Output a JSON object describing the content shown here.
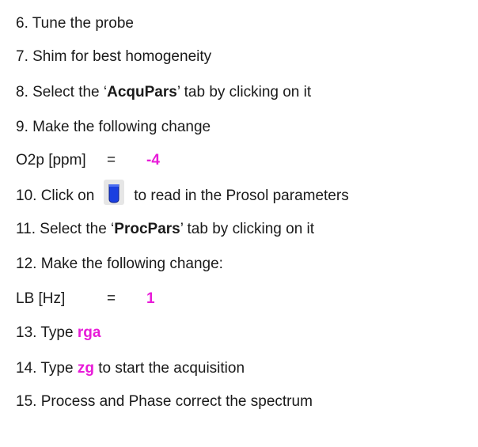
{
  "steps": [
    {
      "text": "6. Tune the probe"
    },
    {
      "text": "7. Shim for best homogeneity"
    },
    {
      "before": "8. Select the ‘",
      "bold": "AcquPars",
      "after": "’ tab by clicking on it"
    },
    {
      "text": "9. Make the following change"
    },
    {
      "param": "O2p [ppm]",
      "eq": "=",
      "value": "-4"
    },
    {
      "before": "10. Click on",
      "icon": "prosol-probe-icon",
      "after": "to read in the Prosol parameters"
    },
    {
      "before": "11. Select the ‘",
      "bold": "ProcPars",
      "after": "’ tab by clicking on it"
    },
    {
      "text": "12. Make the following change:"
    },
    {
      "param": "LB [Hz]",
      "eq": "=",
      "value": "1"
    },
    {
      "before": "13. Type ",
      "command": "rga"
    },
    {
      "before": "14. Type ",
      "command": "zg",
      "after": " to start the acquisition"
    },
    {
      "text": "15. Process and Phase correct the spectrum"
    }
  ],
  "colors": {
    "highlight": "#e81bd8",
    "text": "#1a1a1a",
    "icon_fill": "#1a3fe0",
    "icon_bg": "#e6e6e6"
  }
}
